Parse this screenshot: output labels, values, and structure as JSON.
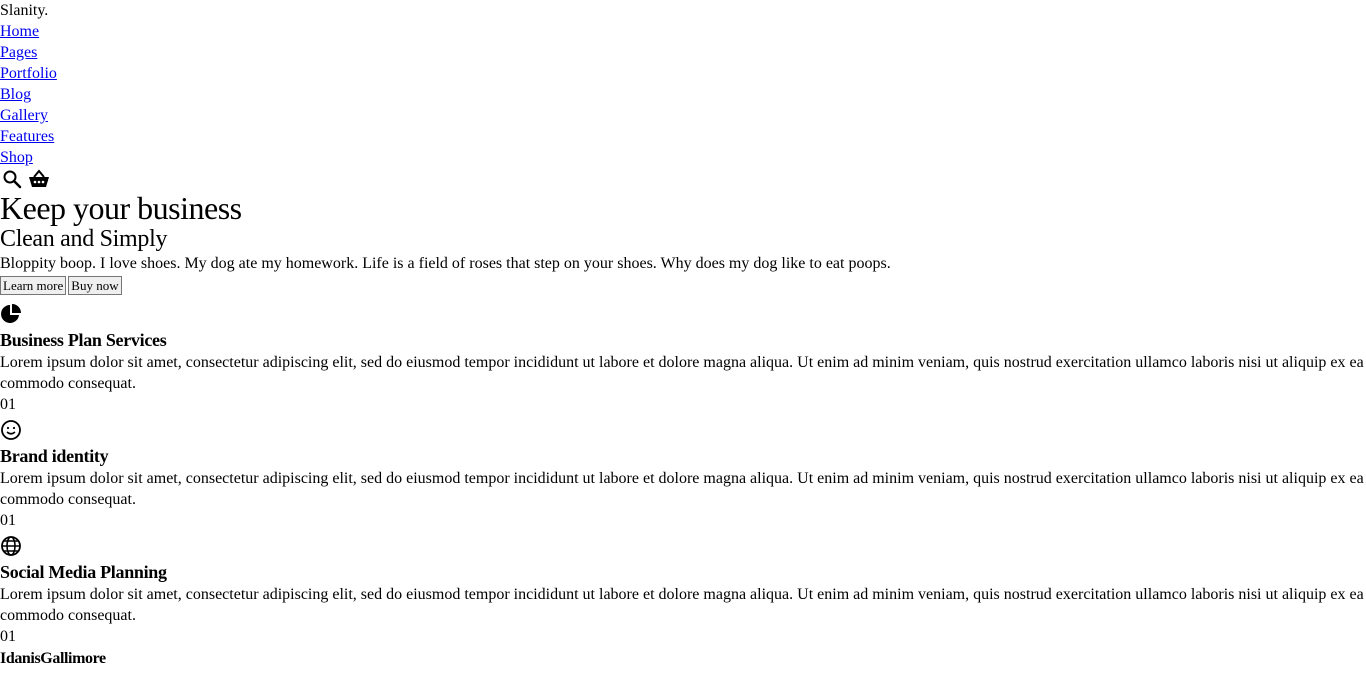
{
  "brand": "Slanity.",
  "nav": {
    "items": [
      "Home",
      "Pages",
      "Portfolio",
      "Blog",
      "Gallery",
      "Features",
      "Shop"
    ]
  },
  "header_icons": [
    "search-icon",
    "basket-icon"
  ],
  "hero": {
    "title": "Keep your business",
    "subtitle": "Clean and Simply",
    "text": "Bloppity boop. I love shoes. My dog ate my homework. Life is a field of roses that step on your shoes. Why does my dog like to eat poops.",
    "learn_more": "Learn more",
    "buy_now": "Buy now"
  },
  "services": [
    {
      "icon": "pie-chart-icon",
      "title": "Business Plan Services",
      "text": "Lorem ipsum dolor sit amet, consectetur adipiscing elit, sed do eiusmod tempor incididunt ut labore et dolore magna aliqua. Ut enim ad minim veniam, quis nostrud exercitation ullamco laboris nisi ut aliquip ex ea commodo consequat.",
      "number": "01"
    },
    {
      "icon": "smiley-icon",
      "title": "Brand identity",
      "text": "Lorem ipsum dolor sit amet, consectetur adipiscing elit, sed do eiusmod tempor incididunt ut labore et dolore magna aliqua. Ut enim ad minim veniam, quis nostrud exercitation ullamco laboris nisi ut aliquip ex ea commodo consequat.",
      "number": "01"
    },
    {
      "icon": "globe-icon",
      "title": "Social Media Planning",
      "text": "Lorem ipsum dolor sit amet, consectetur adipiscing elit, sed do eiusmod tempor incididunt ut labore et dolore magna aliqua. Ut enim ad minim veniam, quis nostrud exercitation ullamco laboris nisi ut aliquip ex ea commodo consequat.",
      "number": "01"
    }
  ],
  "author": "IdanisGallimore"
}
